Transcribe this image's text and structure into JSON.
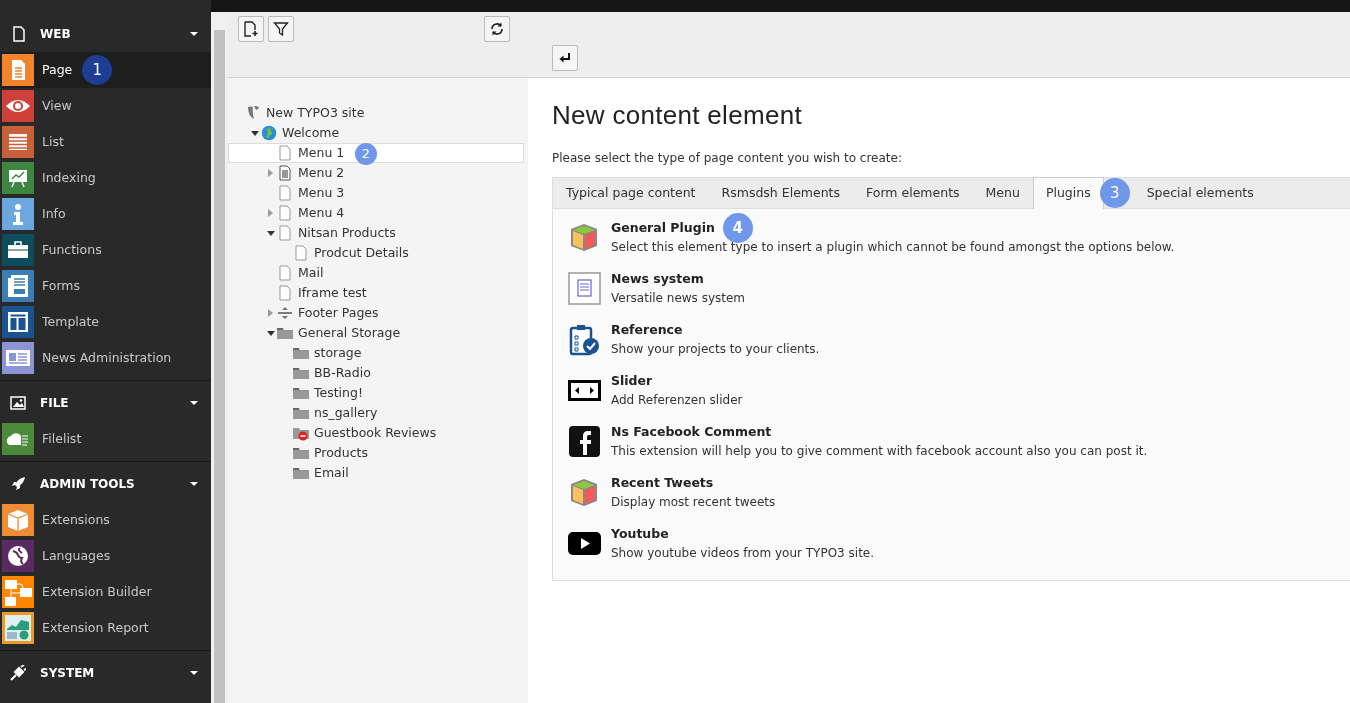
{
  "sidebar": {
    "groups": [
      {
        "title": "WEB",
        "expanded": true,
        "items": [
          {
            "label": "Page",
            "color": "#f0832c",
            "selected": true,
            "callout": {
              "text": "1",
              "color": "#1d3e92"
            }
          },
          {
            "label": "View",
            "color": "#d0403a",
            "selected": false
          },
          {
            "label": "List",
            "color": "#c8603a",
            "selected": false
          },
          {
            "label": "Indexing",
            "color": "#3e8542",
            "selected": false
          },
          {
            "label": "Info",
            "color": "#6ca7df",
            "selected": false
          },
          {
            "label": "Functions",
            "color": "#0d4d5e",
            "selected": false
          },
          {
            "label": "Forms",
            "color": "#3c7db5",
            "selected": false
          },
          {
            "label": "Template",
            "color": "#1b5391",
            "selected": false
          },
          {
            "label": "News Administration",
            "color": "#8d94d6",
            "selected": false
          }
        ]
      },
      {
        "title": "FILE",
        "expanded": true,
        "items": [
          {
            "label": "Filelist",
            "color": "#4a8a3a",
            "selected": false
          }
        ]
      },
      {
        "title": "ADMIN TOOLS",
        "expanded": true,
        "items": [
          {
            "label": "Extensions",
            "color": "#f08c35",
            "selected": false
          },
          {
            "label": "Languages",
            "color": "#5b2a63",
            "selected": false
          },
          {
            "label": "Extension Builder",
            "color": "#ff8700",
            "selected": false
          },
          {
            "label": "Extension Report",
            "color": "#e89c2a",
            "selected": false
          }
        ]
      },
      {
        "title": "SYSTEM",
        "expanded": true
      }
    ]
  },
  "page_tree": {
    "nodes": [
      {
        "label": "New TYPO3 site",
        "kind": "site",
        "selected": false,
        "children": [
          {
            "label": "Welcome",
            "kind": "globe",
            "expanded": true,
            "selected": false,
            "children": [
              {
                "label": "Menu 1",
                "kind": "page",
                "selected": true,
                "callout": {
                  "text": "2",
                  "color": "#6f97ea"
                }
              },
              {
                "label": "Menu 2",
                "kind": "page-list",
                "expanded": false,
                "selected": false
              },
              {
                "label": "Menu 3",
                "kind": "page",
                "selected": false
              },
              {
                "label": "Menu 4",
                "kind": "page",
                "expanded": false,
                "selected": false
              },
              {
                "label": "Nitsan Products",
                "kind": "page",
                "expanded": true,
                "selected": false,
                "children": [
                  {
                    "label": "Prodcut Details",
                    "kind": "page",
                    "selected": false
                  }
                ]
              },
              {
                "label": "Mail",
                "kind": "page",
                "selected": false
              },
              {
                "label": "Iframe test",
                "kind": "page",
                "selected": false
              },
              {
                "label": "Footer Pages",
                "kind": "spacer",
                "expanded": false,
                "selected": false
              },
              {
                "label": "General Storage",
                "kind": "folder",
                "expanded": true,
                "selected": false,
                "children": [
                  {
                    "label": "storage",
                    "kind": "folder",
                    "selected": false
                  },
                  {
                    "label": "BB-Radio",
                    "kind": "folder",
                    "selected": false
                  },
                  {
                    "label": "Testing!",
                    "kind": "folder",
                    "selected": false
                  },
                  {
                    "label": "ns_gallery",
                    "kind": "folder",
                    "selected": false
                  },
                  {
                    "label": "Guestbook Reviews",
                    "kind": "folder-hidden",
                    "selected": false
                  },
                  {
                    "label": "Products",
                    "kind": "folder",
                    "selected": false
                  },
                  {
                    "label": "Email",
                    "kind": "folder",
                    "selected": false
                  }
                ]
              }
            ]
          }
        ]
      }
    ]
  },
  "content": {
    "title": "New content element",
    "intro": "Please select the type of page content you wish to create:",
    "tabs": [
      {
        "label": "Typical page content",
        "selected": false
      },
      {
        "label": "Rsmsdsh Elements",
        "selected": false
      },
      {
        "label": "Form elements",
        "selected": false
      },
      {
        "label": "Menu",
        "selected": false
      },
      {
        "label": "Plugins",
        "selected": true,
        "callout": {
          "text": "3",
          "color": "#6f97ea"
        }
      },
      {
        "label": "Special elements",
        "selected": false
      }
    ],
    "plugins": [
      {
        "title": "General Plugin",
        "description": "Select this element type to insert a plugin which cannot be found amongst the options below.",
        "kind": "cube",
        "callout": {
          "text": "4",
          "color": "#6f97ea"
        }
      },
      {
        "title": "News system",
        "description": "Versatile news system",
        "kind": "news"
      },
      {
        "title": "Reference",
        "description": "Show your projects to your clients.",
        "kind": "clipboard"
      },
      {
        "title": "Slider",
        "description": "Add Referenzen slider",
        "kind": "slider"
      },
      {
        "title": "Ns Facebook Comment",
        "description": "This extension will help you to give comment with facebook account also you can post it.",
        "kind": "facebook"
      },
      {
        "title": "Recent Tweets",
        "description": "Display most recent tweets",
        "kind": "cube"
      },
      {
        "title": "Youtube",
        "description": "Show youtube videos from your TYPO3 site.",
        "kind": "youtube"
      }
    ]
  }
}
